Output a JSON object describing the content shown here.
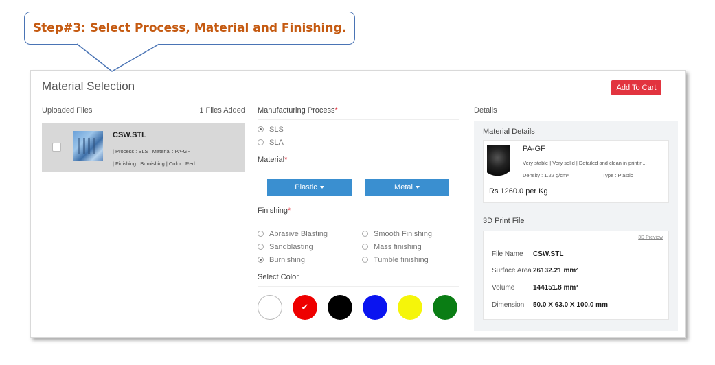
{
  "callout": {
    "text": "Step#3: Select Process, Material and Finishing."
  },
  "panel": {
    "title": "Material Selection",
    "add_to_cart": "Add To Cart"
  },
  "uploads": {
    "heading": "Uploaded Files",
    "count": "1 Files Added",
    "files": [
      {
        "name": "CSW.STL",
        "line1": "| Process : SLS | Material : PA-GF",
        "line2": "| Finishing : Burnishing | Color : Red",
        "checked": false
      }
    ]
  },
  "process": {
    "heading": "Manufacturing Process",
    "required_mark": "*",
    "options": [
      {
        "label": "SLS",
        "selected": true
      },
      {
        "label": "SLA",
        "selected": false
      }
    ]
  },
  "material": {
    "heading": "Material",
    "required_mark": "*",
    "buttons": [
      "Plastic",
      "Metal"
    ]
  },
  "finishing": {
    "heading": "Finishing",
    "required_mark": "*",
    "options": [
      {
        "label": "Abrasive Blasting",
        "selected": false
      },
      {
        "label": "Smooth Finishing",
        "selected": false
      },
      {
        "label": "Sandblasting",
        "selected": false
      },
      {
        "label": "Mass finishing",
        "selected": false
      },
      {
        "label": "Burnishing",
        "selected": true
      },
      {
        "label": "Tumble finishing",
        "selected": false
      }
    ]
  },
  "color": {
    "heading": "Select Color",
    "swatches": [
      {
        "name": "white",
        "hex": "#ffffff",
        "selected": false
      },
      {
        "name": "red",
        "hex": "#ee0000",
        "selected": true
      },
      {
        "name": "black",
        "hex": "#000000",
        "selected": false
      },
      {
        "name": "blue",
        "hex": "#0a14f0",
        "selected": false
      },
      {
        "name": "yellow",
        "hex": "#f5f50a",
        "selected": false
      },
      {
        "name": "green",
        "hex": "#0a7d14",
        "selected": false
      }
    ],
    "check_glyph": "✔"
  },
  "details": {
    "heading": "Details",
    "material_heading": "Material Details",
    "material": {
      "name": "PA-GF",
      "description": "Very stable | Very solid | Detailed and clean in printin...",
      "density": "Density : 1.22 g/cm³",
      "type": "Type : Plastic",
      "price": "Rs 1260.0 per Kg"
    },
    "print_heading": "3D Print File",
    "preview_link": "3D Preview",
    "specs": [
      {
        "label": "File Name",
        "value": "CSW.STL"
      },
      {
        "label": "Surface Area",
        "value": "26132.21 mm²"
      },
      {
        "label": "Volume",
        "value": "144151.8 mm³"
      },
      {
        "label": "Dimension",
        "value": "50.0 X 63.0 X 100.0 mm"
      }
    ]
  },
  "colors": {
    "accent_red": "#e2343f",
    "button_blue": "#3a8fd0",
    "callout_border": "#4a74b5",
    "callout_text": "#c55a11"
  }
}
